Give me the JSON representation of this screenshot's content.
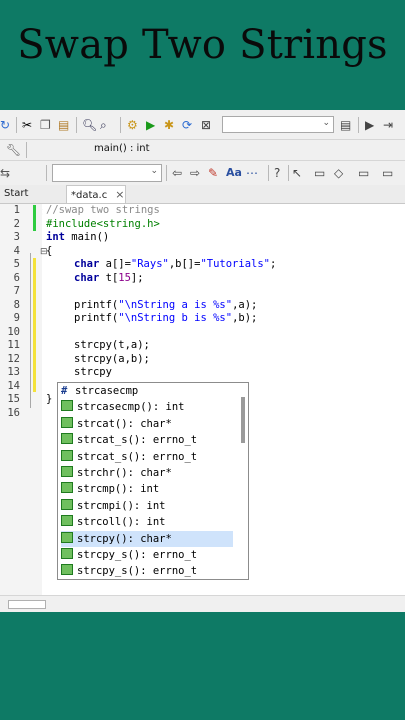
{
  "video_title": "Swap Two Strings",
  "toolbar": {
    "scope_function": "main() : int"
  },
  "tabs": [
    {
      "label": "Start here",
      "close": "×"
    },
    {
      "label": "*data.c",
      "close": "×"
    }
  ],
  "editor": {
    "line_numbers": [
      "1",
      "2",
      "3",
      "4",
      "5",
      "6",
      "7",
      "8",
      "9",
      "10",
      "11",
      "12",
      "13",
      "14",
      "15",
      "16"
    ],
    "code": {
      "l1": "//swap two strings",
      "l2": "#include<string.h>",
      "l3_kw": "int",
      "l3_rest": " main()",
      "l4": "{",
      "l6_kw": "char",
      "l6_a": " a[]=",
      "l6_s1": "\"Rays\"",
      "l6_b": ",b[]=",
      "l6_s2": "\"Tutorials\"",
      "l6_end": ";",
      "l7_kw": "char",
      "l7_a": " t[",
      "l7_num": "15",
      "l7_end": "];",
      "l9_a": "printf(",
      "l9_s": "\"\\nString a is %s\"",
      "l9_end": ",a);",
      "l10_a": "printf(",
      "l10_s": "\"\\nString b is %s\"",
      "l10_end": ",b);",
      "l12": "strcpy(t,a);",
      "l13": "strcpy(a,b);",
      "l14": "strcpy",
      "l15": "}"
    }
  },
  "autocomplete": {
    "items": [
      {
        "kind": "macro",
        "label": "strcasecmp"
      },
      {
        "kind": "function",
        "label": "strcasecmp(): int"
      },
      {
        "kind": "function",
        "label": "strcat(): char*"
      },
      {
        "kind": "function",
        "label": "strcat_s(): errno_t"
      },
      {
        "kind": "function",
        "label": "strcat_s(): errno_t"
      },
      {
        "kind": "function",
        "label": "strchr(): char*"
      },
      {
        "kind": "function",
        "label": "strcmp(): int"
      },
      {
        "kind": "function",
        "label": "strcmpi(): int"
      },
      {
        "kind": "function",
        "label": "strcoll(): int"
      },
      {
        "kind": "function",
        "label": "strcpy(): char*",
        "selected": true
      },
      {
        "kind": "function",
        "label": "strcpy_s(): errno_t"
      },
      {
        "kind": "function",
        "label": "strcpy_s(): errno_t"
      }
    ]
  },
  "colors": {
    "background": "#0e7a65",
    "selection": "#cfe3fb"
  }
}
